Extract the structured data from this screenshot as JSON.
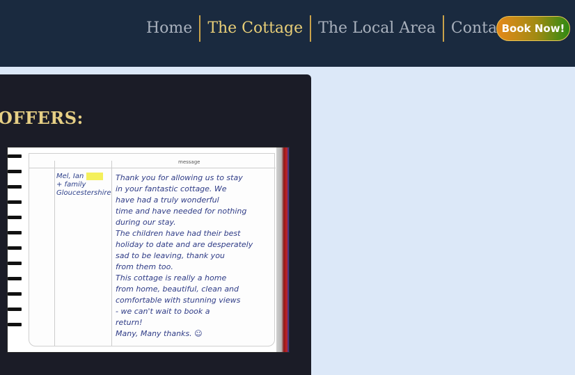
{
  "nav": {
    "items": [
      {
        "label": "Home",
        "active": false
      },
      {
        "label": "The Cottage",
        "active": true
      },
      {
        "label": "The Local Area",
        "active": false
      },
      {
        "label": "Contact Us",
        "active": false
      }
    ],
    "book_label": "Book Now!"
  },
  "section": {
    "title": "OFFERS:"
  },
  "guestbook": {
    "column_header": "message",
    "name_lines": [
      "Mel, Ian",
      "+ family",
      "Gloucestershire"
    ],
    "message_lines": [
      "Thank you for allowing us to stay",
      "in your fantastic cottage. We",
      "have had a truly wonderful",
      "time and have needed for nothing",
      "during our stay.",
      "The children have had their best",
      "holiday to date and are desperately",
      "sad to be leaving, thank you",
      "from them too.",
      "This cottage is really a home",
      "from home, beautiful, clean and",
      "comfortable with stunning views",
      "- we can't wait to book a",
      "return!",
      "Many, Many thanks. ☺"
    ]
  },
  "colors": {
    "header_bg": "#1a2a3f",
    "nav_text": "#a9b1bd",
    "nav_active": "#e9cf78",
    "nav_separator": "#c9a24a",
    "panel_bg": "#1b1c27",
    "page_bg": "#dce8f8",
    "offers_title": "#e6cf85"
  }
}
